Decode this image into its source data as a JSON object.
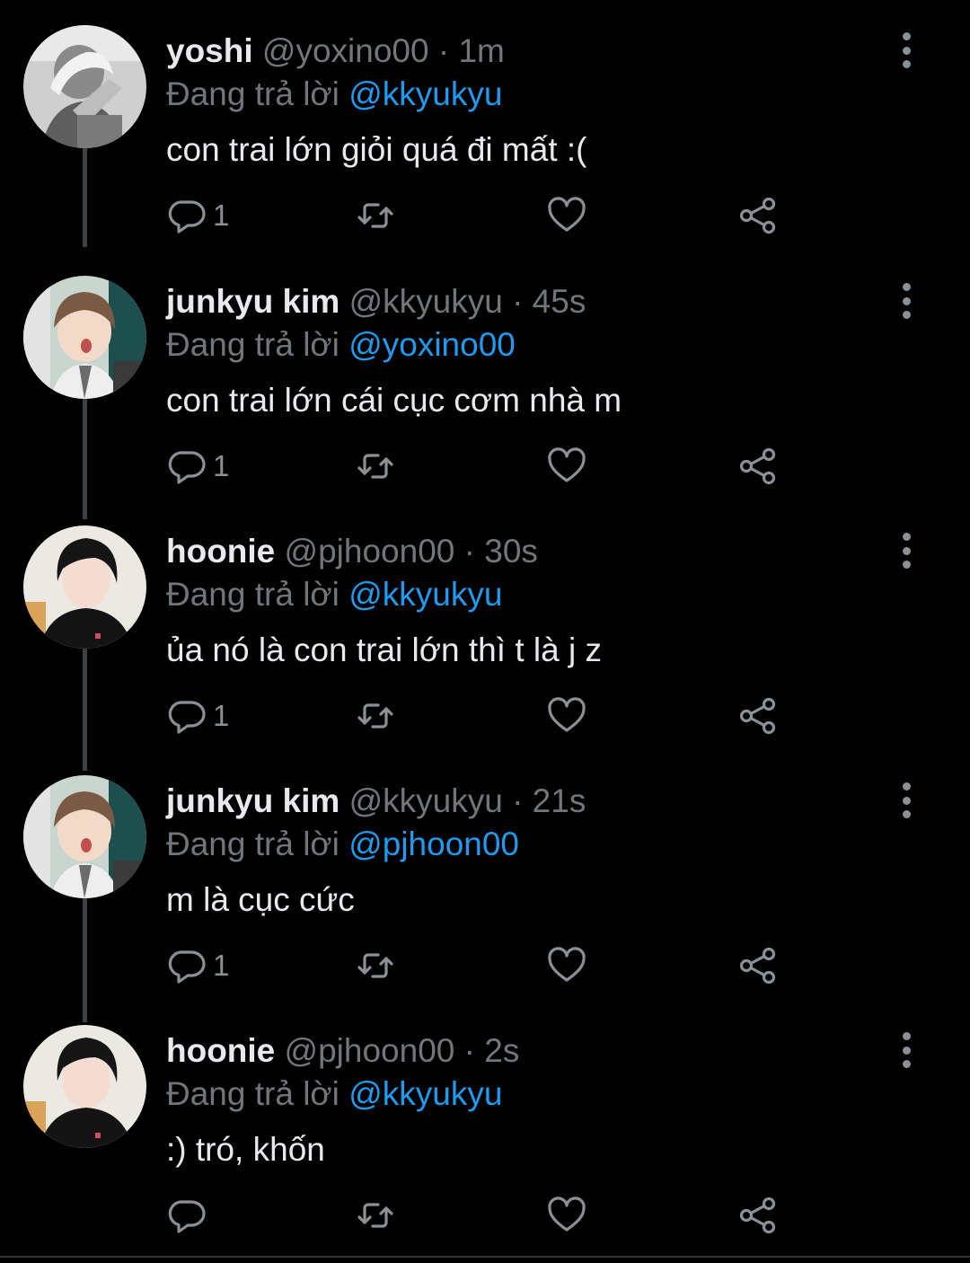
{
  "tweets": [
    {
      "name": "yoshi",
      "handle": "@yoxino00",
      "sep": "·",
      "time": "1m",
      "replying_prefix": "Đang trả lời ",
      "replying_to": "@kkyukyu",
      "text": "con trai lớn giỏi quá đi mất :(",
      "reply_count": "1",
      "avatar": "bw-photo"
    },
    {
      "name": "junkyu kim",
      "handle": "@kkyukyu",
      "sep": "·",
      "time": "45s",
      "replying_prefix": "Đang trả lời ",
      "replying_to": "@yoxino00",
      "text": "con trai lớn cái cục cơm nhà m",
      "reply_count": "1",
      "avatar": "light-photo"
    },
    {
      "name": "hoonie",
      "handle": "@pjhoon00",
      "sep": "·",
      "time": "30s",
      "replying_prefix": "Đang trả lời ",
      "replying_to": "@kkyukyu",
      "text": "ủa nó là con trai lớn thì t là j z",
      "reply_count": "1",
      "avatar": "dark-photo"
    },
    {
      "name": "junkyu kim",
      "handle": "@kkyukyu",
      "sep": "·",
      "time": "21s",
      "replying_prefix": "Đang trả lời ",
      "replying_to": "@pjhoon00",
      "text": "m là cục cức",
      "reply_count": "1",
      "avatar": "light-photo"
    },
    {
      "name": "hoonie",
      "handle": "@pjhoon00",
      "sep": "·",
      "time": "2s",
      "replying_prefix": "Đang trả lời ",
      "replying_to": "@kkyukyu",
      "text": ":) tró, khốn",
      "reply_count": "",
      "avatar": "dark-photo"
    }
  ],
  "colors": {
    "background": "#000000",
    "text": "#e7e9ea",
    "muted": "#71767b",
    "mention": "#1d9bf0",
    "icon": "#8b9096"
  },
  "icons": [
    "reply-icon",
    "retweet-icon",
    "like-icon",
    "share-icon",
    "more-options-icon"
  ]
}
